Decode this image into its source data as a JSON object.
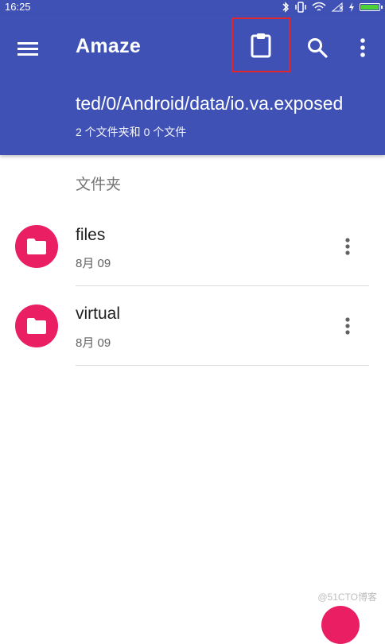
{
  "status_bar": {
    "time": "16:25",
    "icons": [
      "bluetooth-icon",
      "vibrate-icon",
      "wifi-icon",
      "signal-icon",
      "charging-icon",
      "battery-icon"
    ]
  },
  "app_bar": {
    "title": "Amaze",
    "path": "ted/0/Android/data/io.va.exposed",
    "summary": "2 个文件夹和 0 个文件",
    "background_color": "#3f51b5",
    "highlight_color": "#e0262b"
  },
  "list": {
    "section_label": "文件夹",
    "items": [
      {
        "name": "files",
        "date": "8月 09",
        "icon": "folder-icon"
      },
      {
        "name": "virtual",
        "date": "8月 09",
        "icon": "folder-icon"
      }
    ],
    "folder_color": "#e91e63"
  },
  "watermark": "@51CTO博客"
}
